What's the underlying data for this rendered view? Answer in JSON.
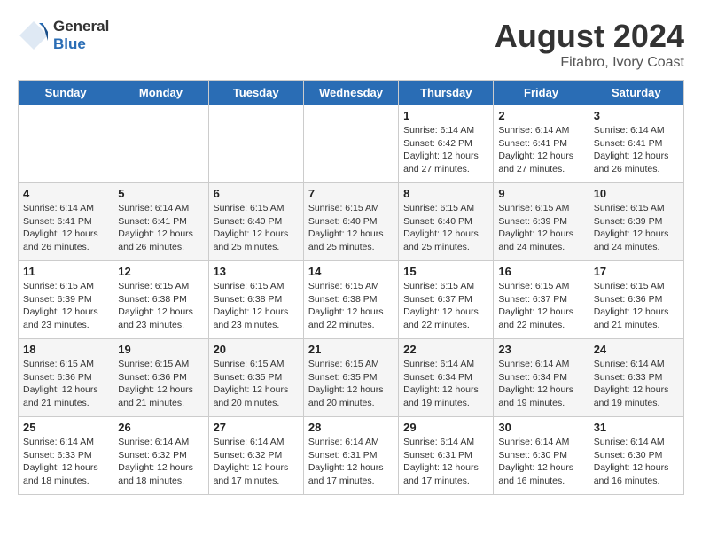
{
  "header": {
    "logo_general": "General",
    "logo_blue": "Blue",
    "month_year": "August 2024",
    "location": "Fitabro, Ivory Coast"
  },
  "days_of_week": [
    "Sunday",
    "Monday",
    "Tuesday",
    "Wednesday",
    "Thursday",
    "Friday",
    "Saturday"
  ],
  "weeks": [
    [
      {
        "day": "",
        "info": ""
      },
      {
        "day": "",
        "info": ""
      },
      {
        "day": "",
        "info": ""
      },
      {
        "day": "",
        "info": ""
      },
      {
        "day": "1",
        "info": "Sunrise: 6:14 AM\nSunset: 6:42 PM\nDaylight: 12 hours\nand 27 minutes."
      },
      {
        "day": "2",
        "info": "Sunrise: 6:14 AM\nSunset: 6:41 PM\nDaylight: 12 hours\nand 27 minutes."
      },
      {
        "day": "3",
        "info": "Sunrise: 6:14 AM\nSunset: 6:41 PM\nDaylight: 12 hours\nand 26 minutes."
      }
    ],
    [
      {
        "day": "4",
        "info": "Sunrise: 6:14 AM\nSunset: 6:41 PM\nDaylight: 12 hours\nand 26 minutes."
      },
      {
        "day": "5",
        "info": "Sunrise: 6:14 AM\nSunset: 6:41 PM\nDaylight: 12 hours\nand 26 minutes."
      },
      {
        "day": "6",
        "info": "Sunrise: 6:15 AM\nSunset: 6:40 PM\nDaylight: 12 hours\nand 25 minutes."
      },
      {
        "day": "7",
        "info": "Sunrise: 6:15 AM\nSunset: 6:40 PM\nDaylight: 12 hours\nand 25 minutes."
      },
      {
        "day": "8",
        "info": "Sunrise: 6:15 AM\nSunset: 6:40 PM\nDaylight: 12 hours\nand 25 minutes."
      },
      {
        "day": "9",
        "info": "Sunrise: 6:15 AM\nSunset: 6:39 PM\nDaylight: 12 hours\nand 24 minutes."
      },
      {
        "day": "10",
        "info": "Sunrise: 6:15 AM\nSunset: 6:39 PM\nDaylight: 12 hours\nand 24 minutes."
      }
    ],
    [
      {
        "day": "11",
        "info": "Sunrise: 6:15 AM\nSunset: 6:39 PM\nDaylight: 12 hours\nand 23 minutes."
      },
      {
        "day": "12",
        "info": "Sunrise: 6:15 AM\nSunset: 6:38 PM\nDaylight: 12 hours\nand 23 minutes."
      },
      {
        "day": "13",
        "info": "Sunrise: 6:15 AM\nSunset: 6:38 PM\nDaylight: 12 hours\nand 23 minutes."
      },
      {
        "day": "14",
        "info": "Sunrise: 6:15 AM\nSunset: 6:38 PM\nDaylight: 12 hours\nand 22 minutes."
      },
      {
        "day": "15",
        "info": "Sunrise: 6:15 AM\nSunset: 6:37 PM\nDaylight: 12 hours\nand 22 minutes."
      },
      {
        "day": "16",
        "info": "Sunrise: 6:15 AM\nSunset: 6:37 PM\nDaylight: 12 hours\nand 22 minutes."
      },
      {
        "day": "17",
        "info": "Sunrise: 6:15 AM\nSunset: 6:36 PM\nDaylight: 12 hours\nand 21 minutes."
      }
    ],
    [
      {
        "day": "18",
        "info": "Sunrise: 6:15 AM\nSunset: 6:36 PM\nDaylight: 12 hours\nand 21 minutes."
      },
      {
        "day": "19",
        "info": "Sunrise: 6:15 AM\nSunset: 6:36 PM\nDaylight: 12 hours\nand 21 minutes."
      },
      {
        "day": "20",
        "info": "Sunrise: 6:15 AM\nSunset: 6:35 PM\nDaylight: 12 hours\nand 20 minutes."
      },
      {
        "day": "21",
        "info": "Sunrise: 6:15 AM\nSunset: 6:35 PM\nDaylight: 12 hours\nand 20 minutes."
      },
      {
        "day": "22",
        "info": "Sunrise: 6:14 AM\nSunset: 6:34 PM\nDaylight: 12 hours\nand 19 minutes."
      },
      {
        "day": "23",
        "info": "Sunrise: 6:14 AM\nSunset: 6:34 PM\nDaylight: 12 hours\nand 19 minutes."
      },
      {
        "day": "24",
        "info": "Sunrise: 6:14 AM\nSunset: 6:33 PM\nDaylight: 12 hours\nand 19 minutes."
      }
    ],
    [
      {
        "day": "25",
        "info": "Sunrise: 6:14 AM\nSunset: 6:33 PM\nDaylight: 12 hours\nand 18 minutes."
      },
      {
        "day": "26",
        "info": "Sunrise: 6:14 AM\nSunset: 6:32 PM\nDaylight: 12 hours\nand 18 minutes."
      },
      {
        "day": "27",
        "info": "Sunrise: 6:14 AM\nSunset: 6:32 PM\nDaylight: 12 hours\nand 17 minutes."
      },
      {
        "day": "28",
        "info": "Sunrise: 6:14 AM\nSunset: 6:31 PM\nDaylight: 12 hours\nand 17 minutes."
      },
      {
        "day": "29",
        "info": "Sunrise: 6:14 AM\nSunset: 6:31 PM\nDaylight: 12 hours\nand 17 minutes."
      },
      {
        "day": "30",
        "info": "Sunrise: 6:14 AM\nSunset: 6:30 PM\nDaylight: 12 hours\nand 16 minutes."
      },
      {
        "day": "31",
        "info": "Sunrise: 6:14 AM\nSunset: 6:30 PM\nDaylight: 12 hours\nand 16 minutes."
      }
    ]
  ]
}
